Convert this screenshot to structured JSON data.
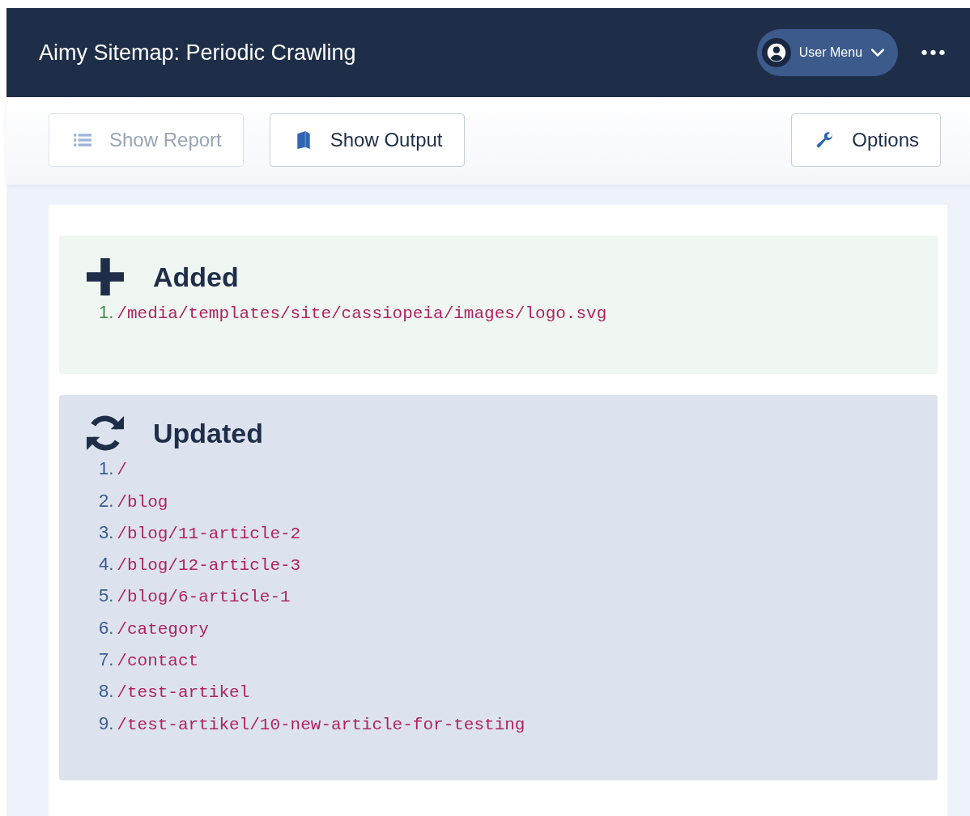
{
  "header": {
    "title": "Aimy Sitemap: Periodic Crawling",
    "user_menu": {
      "label": "User Menu"
    },
    "more": {
      "label": "•••"
    }
  },
  "toolbar": {
    "buttons": [
      {
        "kind": "report",
        "label": "Show Report",
        "disabled": true
      },
      {
        "kind": "output",
        "label": "Show Output",
        "disabled": false
      },
      {
        "kind": "options",
        "label": "Options",
        "disabled": false
      }
    ]
  },
  "sections": [
    {
      "kind": "added",
      "title": "Added",
      "items": [
        {
          "number": "1.",
          "path": "/media/templates/site/cassiopeia/images/logo.svg"
        }
      ]
    },
    {
      "kind": "updated",
      "title": "Updated",
      "items": [
        {
          "number": "1.",
          "path": "/"
        },
        {
          "number": "2.",
          "path": "/blog"
        },
        {
          "number": "3.",
          "path": "/blog/11-article-2"
        },
        {
          "number": "4.",
          "path": "/blog/12-article-3"
        },
        {
          "number": "5.",
          "path": "/blog/6-article-1"
        },
        {
          "number": "6.",
          "path": "/category"
        },
        {
          "number": "7.",
          "path": "/contact"
        },
        {
          "number": "8.",
          "path": "/test-artikel"
        },
        {
          "number": "9.",
          "path": "/test-artikel/10-new-article-for-testing"
        }
      ]
    }
  ]
}
